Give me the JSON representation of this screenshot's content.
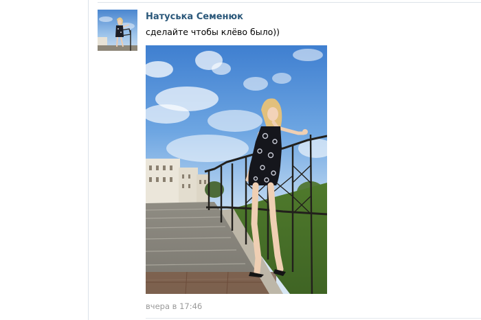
{
  "post": {
    "author_name": "Натуська Семенюк",
    "text": "сделайте чтобы клёво было))",
    "date": "вчера в 17:46"
  },
  "icons": {
    "avatar": "user-avatar-photo",
    "photo": "attached-photo"
  },
  "colors": {
    "author_link": "#2b587a",
    "date_text": "#999999",
    "divider": "#dae1e8"
  }
}
